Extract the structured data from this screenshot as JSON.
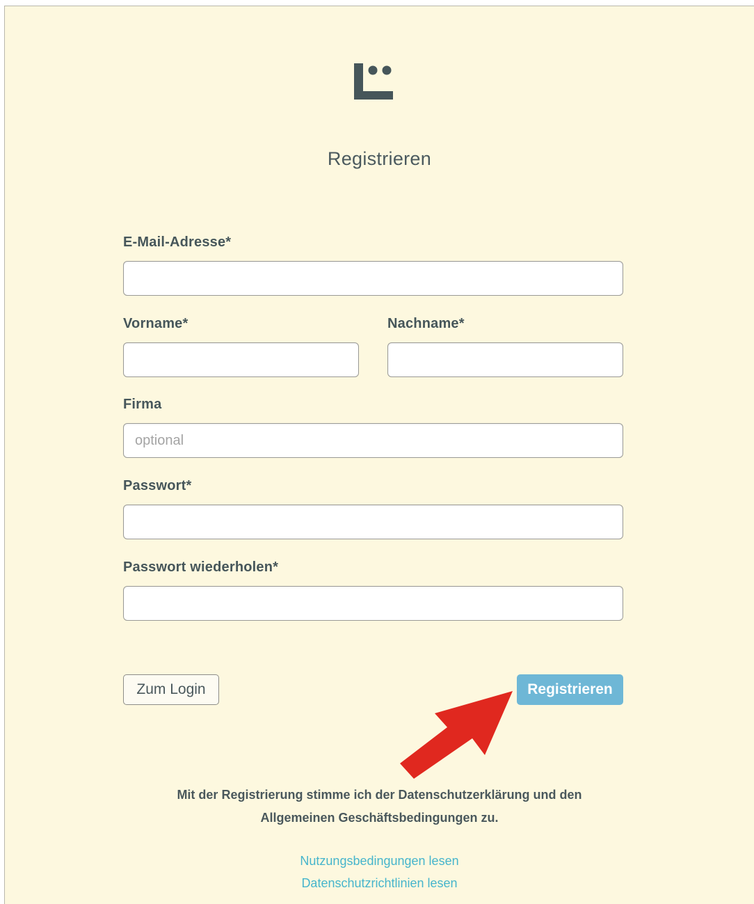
{
  "page": {
    "title": "Registrieren",
    "logo_icon": "logo-icon",
    "colors": {
      "background": "#fdf8df",
      "text": "#46565a",
      "primary_button": "#6eb7d6",
      "link": "#46b5cc",
      "annotation_arrow": "#e0281f"
    }
  },
  "form": {
    "email_label": "E-Mail-Adresse*",
    "email_value": "",
    "firstname_label": "Vorname*",
    "firstname_value": "",
    "lastname_label": "Nachname*",
    "lastname_value": "",
    "company_label": "Firma",
    "company_placeholder": "optional",
    "company_value": "",
    "password_label": "Passwort*",
    "password_value": "",
    "password_repeat_label": "Passwort wiederholen*",
    "password_repeat_value": ""
  },
  "actions": {
    "login_label": "Zum Login",
    "register_label": "Registrieren"
  },
  "footer": {
    "consent_line1": "Mit der Registrierung stimme ich der Datenschutzerklärung und den",
    "consent_line2": "Allgemeinen Geschäftsbedingungen zu.",
    "terms_link": "Nutzungsbedingungen lesen",
    "privacy_link": "Datenschutzrichtlinien lesen"
  }
}
